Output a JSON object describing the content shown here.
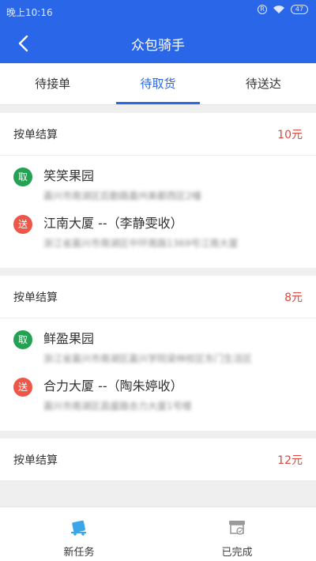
{
  "status_bar": {
    "time": "晚上10:16",
    "sim": "R",
    "battery": "47"
  },
  "nav": {
    "title": "众包骑手"
  },
  "tabs": [
    {
      "label": "待接单",
      "active": false
    },
    {
      "label": "待取货",
      "active": true
    },
    {
      "label": "待送达",
      "active": false
    }
  ],
  "orders": [
    {
      "title": "按单结算",
      "price": "10元",
      "pickup": {
        "badge": "取",
        "name": "笑笑果园",
        "detail": "嘉兴市南湖区后勤路嘉州美都西区2幢"
      },
      "dropoff": {
        "badge": "送",
        "name": "江南大厦 --（李静雯收）",
        "detail": "浙江省嘉兴市南湖区中环南路1369号江南大厦"
      }
    },
    {
      "title": "按单结算",
      "price": "8元",
      "pickup": {
        "badge": "取",
        "name": "鲜盈果园",
        "detail": "浙江省嘉兴市南湖区嘉兴学院梁林校区东门生活区"
      },
      "dropoff": {
        "badge": "送",
        "name": "合力大厦 --（陶朱婷收）",
        "detail": "嘉兴市南湖区昌盛路合力大厦1号楼"
      }
    },
    {
      "title": "按单结算",
      "price": "12元"
    }
  ],
  "bottom_nav": [
    {
      "label": "新任务",
      "icon": "new-task-icon",
      "active": true
    },
    {
      "label": "已完成",
      "icon": "completed-icon",
      "active": false
    }
  ],
  "colors": {
    "primary": "#2a67e8",
    "pickup": "#23a253",
    "dropoff": "#ee5647",
    "price": "#e0443c"
  }
}
